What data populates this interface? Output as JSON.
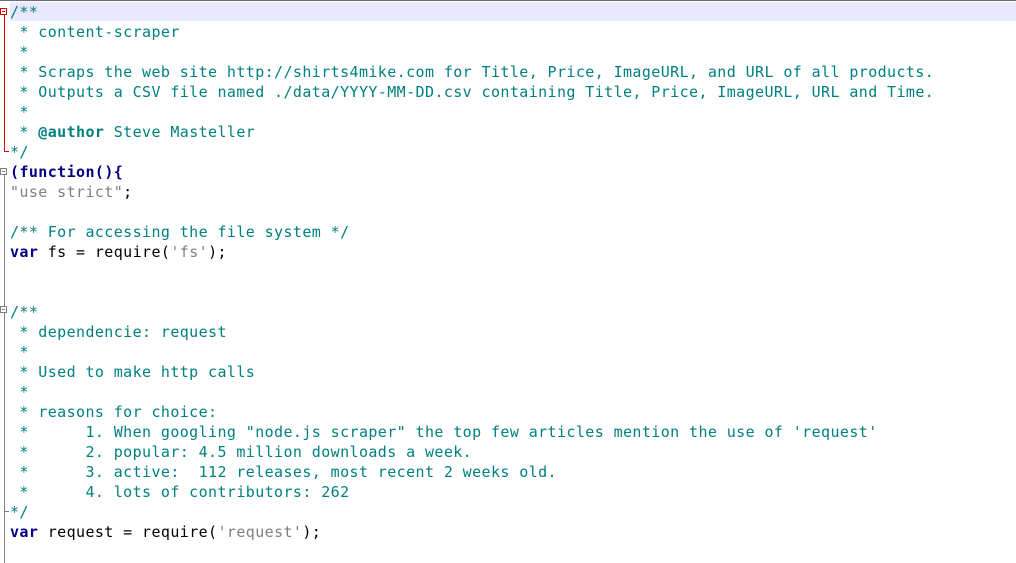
{
  "editor": {
    "lines": [
      [
        {
          "t": "/**",
          "k": "comment"
        }
      ],
      [
        {
          "t": " * content-scraper",
          "k": "comment"
        }
      ],
      [
        {
          "t": " *",
          "k": "comment"
        }
      ],
      [
        {
          "t": " * Scraps the web site http://shirts4mike.com for Title, Price, ImageURL, and URL of all products.",
          "k": "comment"
        }
      ],
      [
        {
          "t": " * Outputs a CSV file named ./data/YYYY-MM-DD.csv containing Title, Price, ImageURL, URL and Time.",
          "k": "comment"
        }
      ],
      [
        {
          "t": " *",
          "k": "comment"
        }
      ],
      [
        {
          "t": " * ",
          "k": "comment"
        },
        {
          "t": "@author",
          "k": "doc-tag"
        },
        {
          "t": " Steve Masteller",
          "k": "comment"
        }
      ],
      [
        {
          "t": "*/",
          "k": "comment"
        }
      ],
      [
        {
          "t": "(",
          "k": "paren"
        },
        {
          "t": "function",
          "k": "keyword"
        },
        {
          "t": "(){",
          "k": "paren"
        }
      ],
      [
        {
          "t": "\"use strict\"",
          "k": "string"
        },
        {
          "t": ";",
          "k": "text"
        }
      ],
      [
        {
          "t": "",
          "k": "text"
        }
      ],
      [
        {
          "t": "/** For accessing the file system */",
          "k": "comment"
        }
      ],
      [
        {
          "t": "var",
          "k": "keyword"
        },
        {
          "t": " fs = require(",
          "k": "text"
        },
        {
          "t": "'fs'",
          "k": "string"
        },
        {
          "t": ");",
          "k": "text"
        }
      ],
      [
        {
          "t": "",
          "k": "text"
        }
      ],
      [
        {
          "t": "",
          "k": "text"
        }
      ],
      [
        {
          "t": "/**",
          "k": "comment"
        }
      ],
      [
        {
          "t": " * dependencie: request",
          "k": "comment"
        }
      ],
      [
        {
          "t": " *",
          "k": "comment"
        }
      ],
      [
        {
          "t": " * Used to make http calls",
          "k": "comment"
        }
      ],
      [
        {
          "t": " *",
          "k": "comment"
        }
      ],
      [
        {
          "t": " * reasons for choice:",
          "k": "comment"
        }
      ],
      [
        {
          "t": " *      1. When googling \"node.js scraper\" the top few articles mention the use of 'request'",
          "k": "comment"
        }
      ],
      [
        {
          "t": " *      2. popular: 4.5 million downloads a week.",
          "k": "comment"
        }
      ],
      [
        {
          "t": " *      3. active:  112 releases, most recent 2 weeks old.",
          "k": "comment"
        }
      ],
      [
        {
          "t": " *      4. lots of contributors: 262",
          "k": "comment"
        }
      ],
      [
        {
          "t": "*/",
          "k": "comment"
        }
      ],
      [
        {
          "t": "var",
          "k": "keyword"
        },
        {
          "t": " request = require(",
          "k": "text"
        },
        {
          "t": "'request'",
          "k": "string"
        },
        {
          "t": ");",
          "k": "text"
        }
      ]
    ]
  }
}
